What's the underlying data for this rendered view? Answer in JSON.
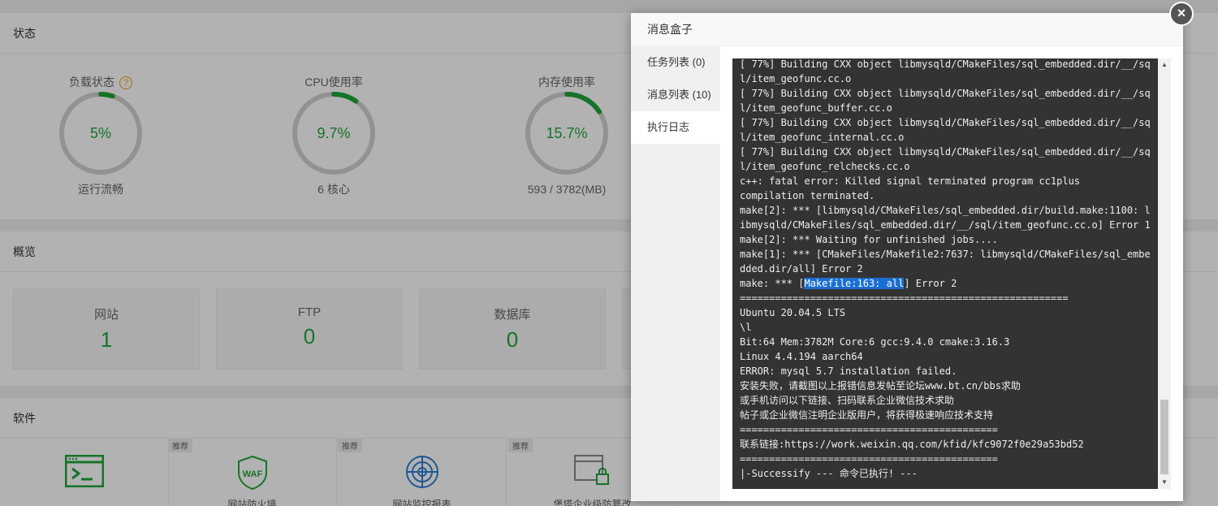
{
  "dashboard": {
    "status": {
      "title": "状态",
      "gauges": [
        {
          "title": "负载状态",
          "value": "5%",
          "sub": "运行流畅",
          "percent": 5,
          "has_help": true,
          "help_icon": "?"
        },
        {
          "title": "CPU使用率",
          "value": "9.7%",
          "sub": "6 核心",
          "percent": 9.7,
          "has_help": false
        },
        {
          "title": "内存使用率",
          "value": "15.7%",
          "sub": "593 / 3782(MB)",
          "percent": 15.7,
          "has_help": false
        }
      ]
    },
    "overview": {
      "title": "概览",
      "cards": [
        {
          "label": "网站",
          "value": "1"
        },
        {
          "label": "FTP",
          "value": "0"
        },
        {
          "label": "数据库",
          "value": "0"
        }
      ]
    },
    "software": {
      "title": "软件",
      "items": [
        {
          "badge": "",
          "name": "",
          "icon": "terminal-icon"
        },
        {
          "badge": "推荐",
          "name": "网站防火墙",
          "icon": "waf-shield-icon",
          "icon_text": "WAF"
        },
        {
          "badge": "推荐",
          "name": "网站监控报表",
          "icon": "radar-icon"
        },
        {
          "badge": "推荐",
          "name": "堡塔企业级防篡改",
          "icon": "lock-window-icon"
        }
      ]
    }
  },
  "colors": {
    "accent": "#20a53a",
    "ring_track": "#d2d2d2",
    "terminal_bg": "#333333",
    "selection": "#1a6fd3"
  },
  "modal": {
    "title": "消息盒子",
    "close_label": "×",
    "tabs": [
      {
        "label": "任务列表 (0)",
        "active": false
      },
      {
        "label": "消息列表 (10)",
        "active": false
      },
      {
        "label": "执行日志",
        "active": true
      }
    ],
    "log_lines": [
      "[ 77%] Building CXX object libmysqld/CMakeFiles/sql_embedded.dir/__/sq",
      "l/item_geofunc.cc.o",
      "[ 77%] Building CXX object libmysqld/CMakeFiles/sql_embedded.dir/__/sq",
      "l/item_geofunc_buffer.cc.o",
      "[ 77%] Building CXX object libmysqld/CMakeFiles/sql_embedded.dir/__/sq",
      "l/item_geofunc_internal.cc.o",
      "[ 77%] Building CXX object libmysqld/CMakeFiles/sql_embedded.dir/__/sq",
      "l/item_geofunc_relchecks.cc.o",
      "c++: fatal error: Killed signal terminated program cc1plus",
      "compilation terminated.",
      "make[2]: *** [libmysqld/CMakeFiles/sql_embedded.dir/build.make:1100: l",
      "ibmysqld/CMakeFiles/sql_embedded.dir/__/sql/item_geofunc.cc.o] Error 1",
      "make[2]: *** Waiting for unfinished jobs....",
      "make[1]: *** [CMakeFiles/Makefile2:7637: libmysqld/CMakeFiles/sql_embe",
      "dded.dir/all] Error 2",
      "make: *** [Makefile:163: all] Error 2",
      "========================================================",
      "Ubuntu 20.04.5 LTS",
      "\\l",
      "Bit:64 Mem:3782M Core:6 gcc:9.4.0 cmake:3.16.3",
      "Linux 4.4.194 aarch64",
      "ERROR: mysql 5.7 installation failed.",
      "安装失败，请截图以上报错信息发帖至论坛www.bt.cn/bbs求助",
      "或手机访问以下链接、扫码联系企业微信技术求助",
      "帖子或企业微信注明企业版用户，将获得极速响应技术支持",
      "============================================",
      "联系链接:https://work.weixin.qq.com/kfid/kfc9072f0e29a53bd52",
      "============================================",
      "|-Successify --- 命令已执行! ---"
    ],
    "selected_text": "Makefile:163: all"
  }
}
